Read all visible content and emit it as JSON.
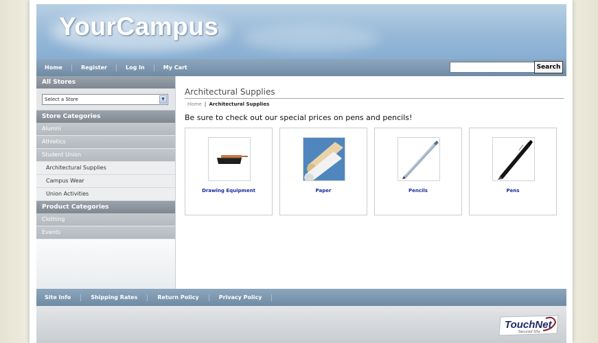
{
  "header": {
    "logo_text": "YourCampus"
  },
  "nav": {
    "links": [
      "Home",
      "Register",
      "Log In",
      "My Cart"
    ],
    "search": {
      "value": "",
      "button_label": "Search"
    }
  },
  "sidebar": {
    "stores_heading": "All Stores",
    "store_select_value": "Select a Store",
    "store_categories_heading": "Store Categories",
    "store_categories": [
      "Alumni",
      "Athletics",
      "Student Union"
    ],
    "student_union_subitems": [
      "Architectural Supplies",
      "Campus Wear",
      "Union Activities"
    ],
    "product_categories_heading": "Product Categories",
    "product_categories": [
      "Clothing",
      "Events"
    ]
  },
  "main": {
    "title": "Architectural Supplies",
    "breadcrumb": {
      "home": "Home",
      "separator": "|",
      "current": "Architectural Supplies"
    },
    "promo": "Be sure to check out our special prices on pens and pencils!",
    "products": [
      {
        "name": "Drawing Equipment",
        "icon": "brush-icon"
      },
      {
        "name": "Paper",
        "icon": "paper-rolls-icon"
      },
      {
        "name": "Pencils",
        "icon": "pencil-icon"
      },
      {
        "name": "Pens",
        "icon": "pen-icon"
      }
    ]
  },
  "footer": {
    "links": [
      "Site Info",
      "Shipping Rates",
      "Return Policy",
      "Privacy Policy"
    ],
    "badge_text": "TouchNet",
    "badge_subtext": "Secured Site"
  },
  "colors": {
    "nav_bar": "#7d97ae",
    "product_link": "#1a2a9c",
    "sidebar_heading": "#8a939b"
  }
}
